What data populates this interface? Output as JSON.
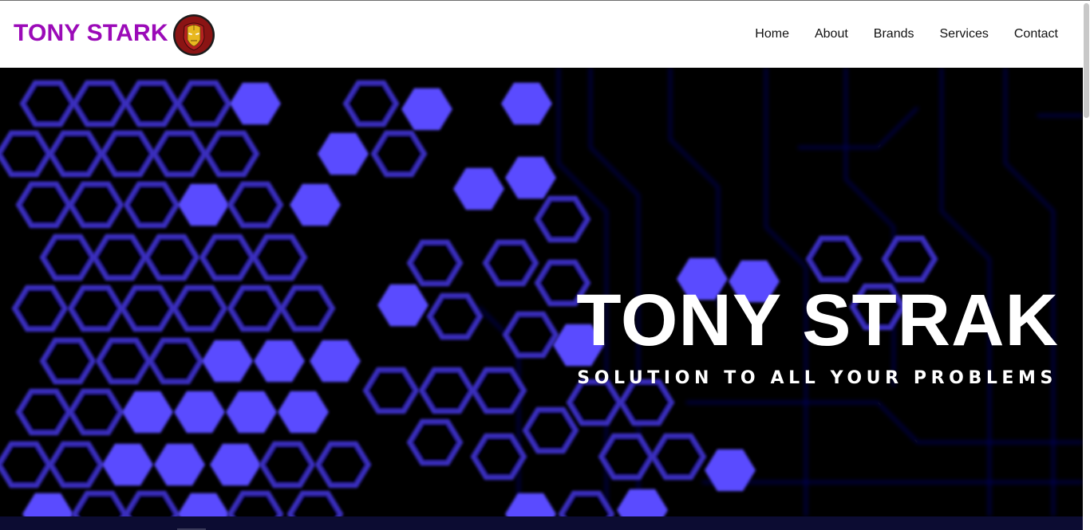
{
  "header": {
    "brand": "TONY STARK",
    "logo_icon": "iron-man-helmet-icon",
    "nav": [
      {
        "label": "Home"
      },
      {
        "label": "About"
      },
      {
        "label": "Brands"
      },
      {
        "label": "Services"
      },
      {
        "label": "Contact"
      }
    ]
  },
  "hero": {
    "title": "TONY STRAK",
    "subtitle": "SOLUTION TO ALL YOUR PROBLEMS",
    "background": "hexagon-circuit-pattern"
  },
  "colors": {
    "brand": "#9b0ab8",
    "hex_fill": "#5a4cff",
    "hex_stroke": "#3a2fbf",
    "hero_bg": "#000000"
  }
}
